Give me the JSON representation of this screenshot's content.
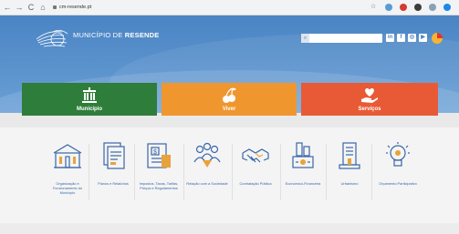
{
  "browser": {
    "url": "cm-resende.pt",
    "back_icon": "back-arrow-icon",
    "forward_icon": "forward-arrow-icon",
    "reload_icon": "reload-icon"
  },
  "header": {
    "brand_prefix": "MUNICÍPIO DE",
    "brand_name": "RESENDE",
    "search_placeholder": "",
    "social": [
      "in",
      "f",
      "◎",
      "▶"
    ]
  },
  "tiles": [
    {
      "label": "Município",
      "color": "#2e7d3a",
      "icon": "town-hall-icon"
    },
    {
      "label": "Viver",
      "color": "#f0962e",
      "icon": "cherries-icon"
    },
    {
      "label": "Serviços",
      "color": "#e85a35",
      "icon": "heart-hand-icon"
    }
  ],
  "services": [
    {
      "label": "Organização e Funcionamento do Município",
      "icon": "buildings-icon"
    },
    {
      "label": "Planos e Relatórios",
      "icon": "documents-icon"
    },
    {
      "label": "Impostos, Taxas, Tarifas, Preços e Regulamentos",
      "icon": "tax-documents-icon"
    },
    {
      "label": "Relação com a Sociedade",
      "icon": "people-group-icon"
    },
    {
      "label": "Contratação Pública",
      "icon": "handshake-icon"
    },
    {
      "label": "Económico-Financeira",
      "icon": "finance-chart-icon"
    },
    {
      "label": "Urbanismo",
      "icon": "urban-buildings-icon"
    },
    {
      "label": "Orçamento Participativo",
      "icon": "lightbulb-icon"
    }
  ]
}
